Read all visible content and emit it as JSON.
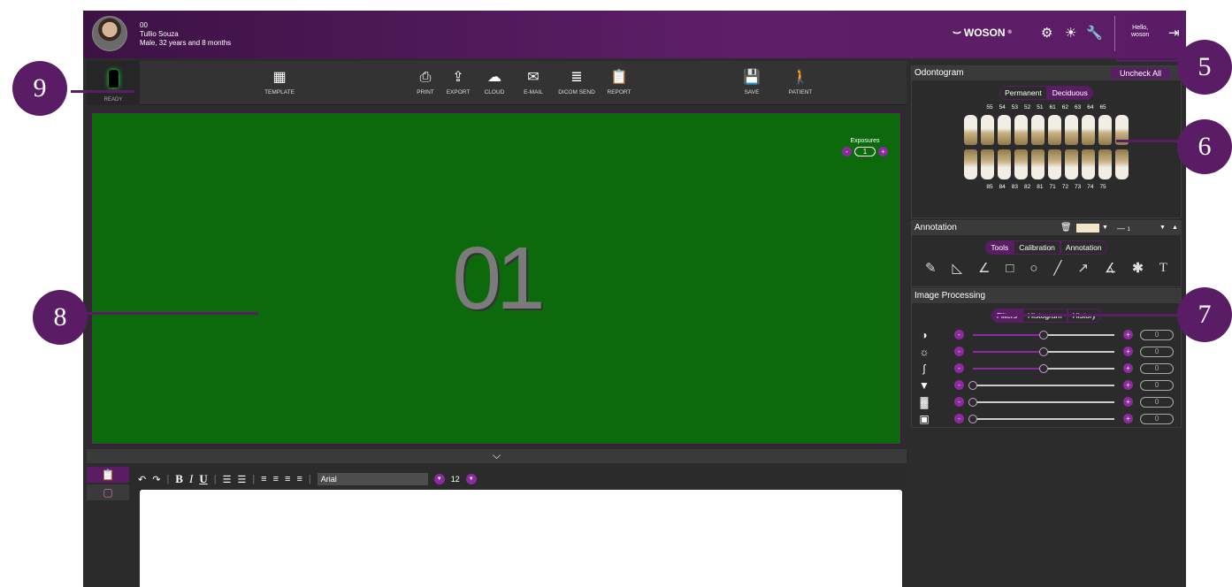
{
  "patient": {
    "id": "00",
    "name": "Tullio Souza",
    "details": "Male, 32 years and 8 months"
  },
  "header": {
    "brand": "WOSON",
    "greeting": "Hello,",
    "username": "woson"
  },
  "toolbar": {
    "ready": "READY",
    "template": "TEMPLATE",
    "print": "PRINT",
    "export": "EXPORT",
    "cloud": "CLOUD",
    "email": "E-MAIL",
    "dicom_send": "DICOM SEND",
    "report": "REPORT",
    "save": "SAVE",
    "patient": "PATIENT"
  },
  "viewer": {
    "big_number": "01",
    "exposures_label": "Exposures",
    "exposures_count": "1"
  },
  "editor": {
    "font": "Arial",
    "size": "12"
  },
  "odontogram": {
    "title": "Odontogram",
    "uncheck_all": "Uncheck All",
    "tabs": [
      "Permanent",
      "Deciduous"
    ],
    "upper": [
      "55",
      "54",
      "53",
      "52",
      "51",
      "61",
      "62",
      "63",
      "64",
      "65"
    ],
    "lower": [
      "85",
      "84",
      "83",
      "82",
      "81",
      "71",
      "72",
      "73",
      "74",
      "75"
    ]
  },
  "annotation": {
    "title": "Annotation",
    "line_width": "1",
    "tabs": [
      "Tools",
      "Calibration",
      "Annotation"
    ]
  },
  "image_processing": {
    "title": "Image Processing",
    "tabs": [
      "Filters",
      "Histogram",
      "History"
    ],
    "filters": [
      {
        "icon": "contrast-icon",
        "level": 0.5,
        "value": "0"
      },
      {
        "icon": "brightness-icon",
        "level": 0.5,
        "value": "0"
      },
      {
        "icon": "gamma-curve-icon",
        "level": 0.5,
        "value": "0"
      },
      {
        "icon": "sharpen-icon",
        "level": 0,
        "value": "0"
      },
      {
        "icon": "noise-icon",
        "level": 0,
        "value": "0"
      },
      {
        "icon": "vignette-icon",
        "level": 0,
        "value": "0"
      }
    ]
  },
  "callouts": [
    "9",
    "8",
    "5",
    "6",
    "7"
  ]
}
